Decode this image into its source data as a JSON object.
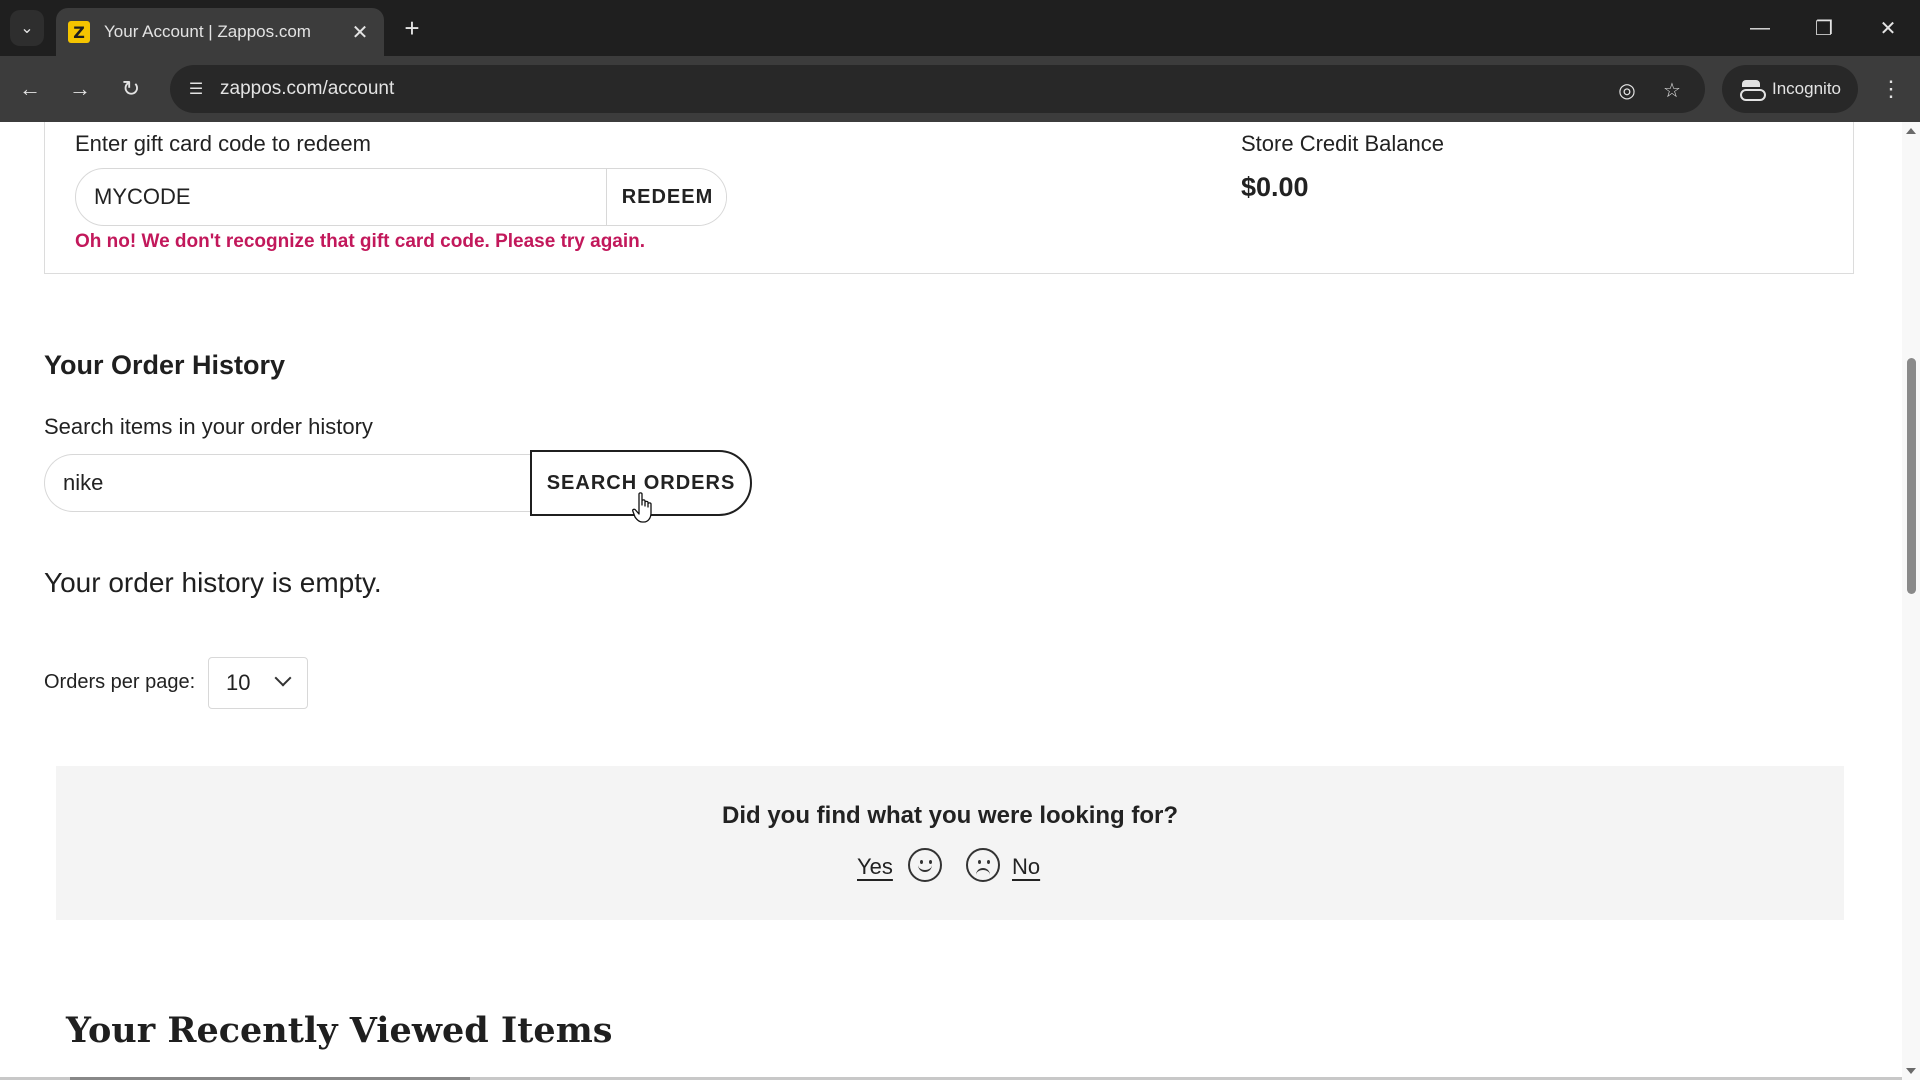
{
  "browser": {
    "tab_title": "Your Account | Zappos.com",
    "favicon_letter": "Z",
    "url": "zappos.com/account",
    "incognito_label": "Incognito",
    "icons": [
      "tab-list-icon",
      "close-icon",
      "plus-icon",
      "minimize-icon",
      "restore-icon",
      "back-icon",
      "forward-icon",
      "reload-icon",
      "site-info-icon",
      "eye-off-icon",
      "star-icon",
      "incognito-icon",
      "more-vert-icon"
    ]
  },
  "gift_card": {
    "label": "Enter gift card code to redeem",
    "input_value": "MYCODE",
    "redeem_label": "REDEEM",
    "error_message": "Oh no! We don't recognize that gift card code. Please try again.",
    "error_color": "#c2185b"
  },
  "store_credit": {
    "label": "Store Credit Balance",
    "value": "$0.00"
  },
  "order_history": {
    "heading": "Your Order History",
    "search_label": "Search items in your order history",
    "search_value": "nike",
    "search_button": "SEARCH ORDERS",
    "empty_message": "Your order history is empty.",
    "per_page_label": "Orders per page:",
    "per_page_value": "10"
  },
  "feedback": {
    "question": "Did you find what you were looking for?",
    "yes_label": "Yes",
    "no_label": "No"
  },
  "recently_viewed": {
    "heading": "Your Recently Viewed Items"
  }
}
